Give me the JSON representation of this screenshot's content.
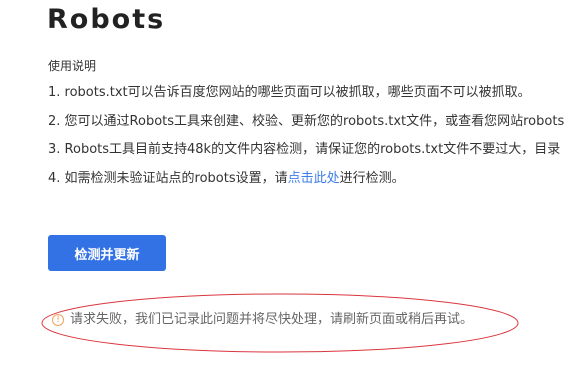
{
  "page": {
    "title": "Robots",
    "usage_heading": "使用说明"
  },
  "instructions": [
    {
      "text": "1. robots.txt可以告诉百度您网站的哪些页面可以被抓取，哪些页面不可以被抓取。"
    },
    {
      "text": "2. 您可以通过Robots工具来创建、校验、更新您的robots.txt文件，或查看您网站robots"
    },
    {
      "text": "3. Robots工具目前支持48k的文件内容检测，请保证您的robots.txt文件不要过大，目录"
    },
    {
      "before": "4. 如需检测未验证站点的robots设置，请",
      "link": "点击此处",
      "after": "进行检测。"
    }
  ],
  "actions": {
    "check_update_label": "检测并更新"
  },
  "error": {
    "icon": "warning-circle-icon",
    "message": "请求失败，我们已记录此问题并将尽快处理，请刷新页面或稍后再试。"
  },
  "colors": {
    "primary": "#3372e4",
    "link": "#3f7ee8",
    "warning": "#f0a35a",
    "annotation": "#d9363e"
  }
}
